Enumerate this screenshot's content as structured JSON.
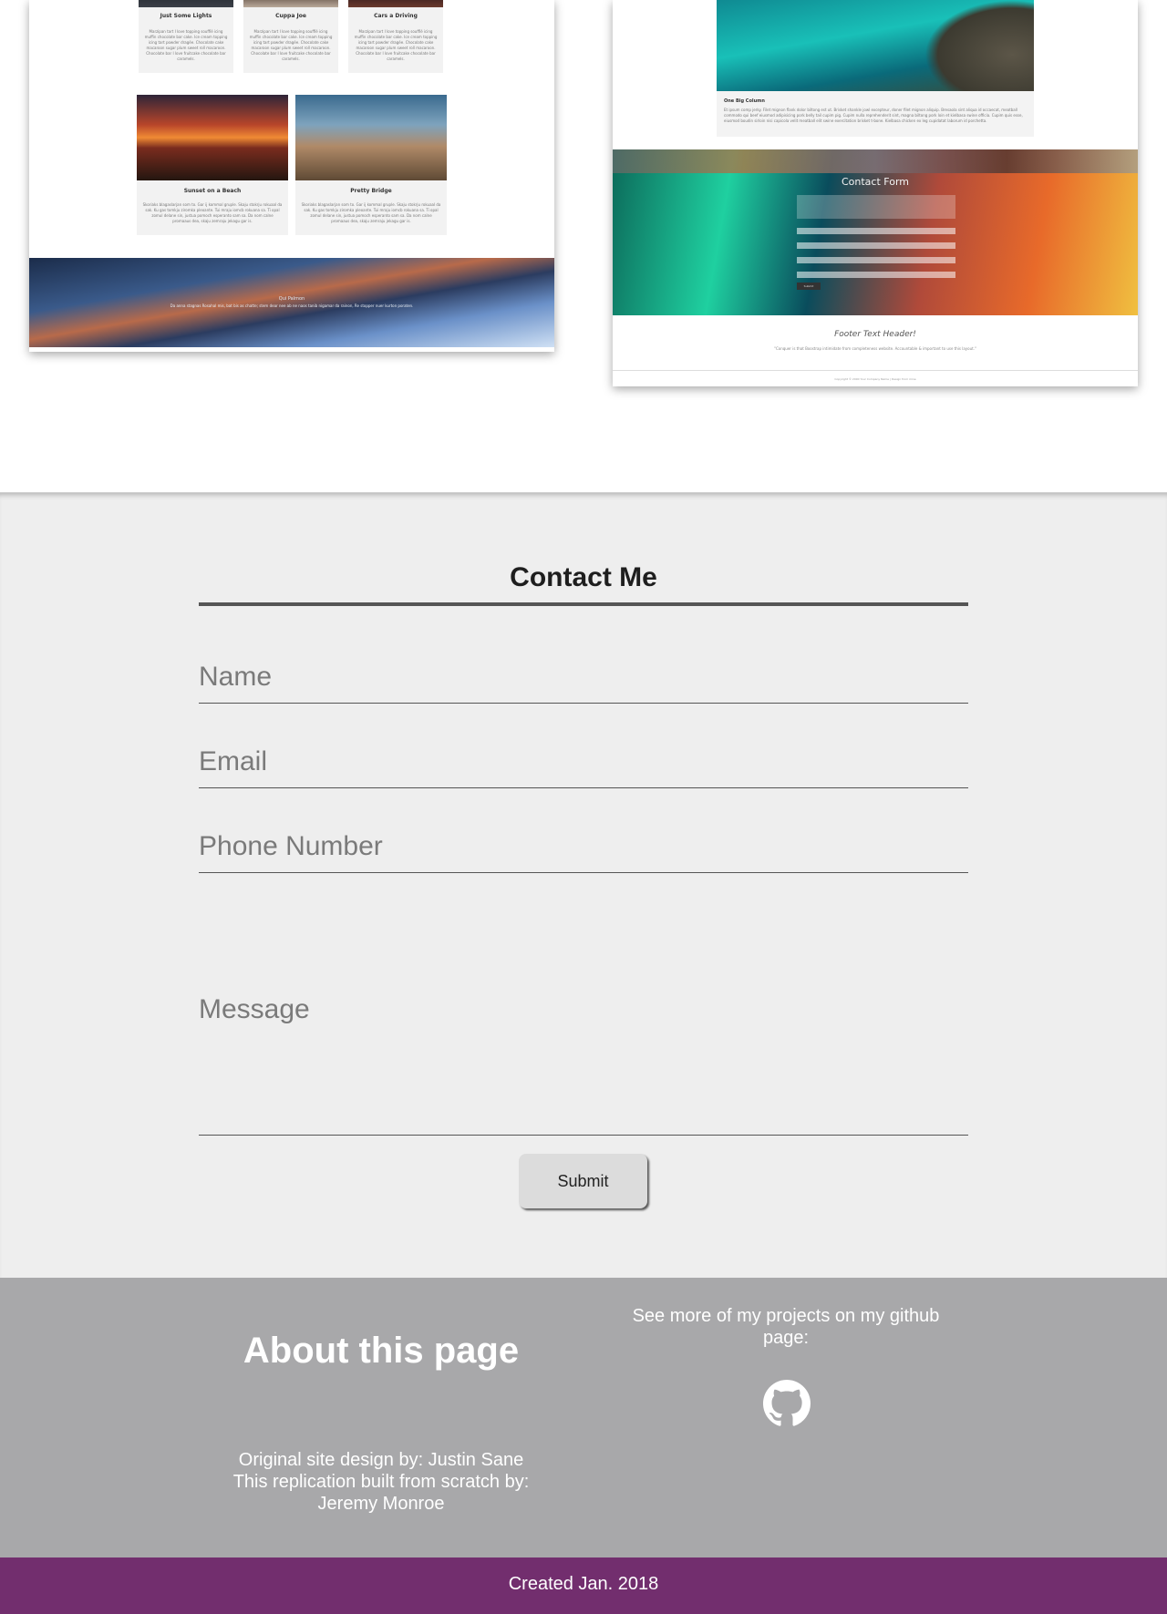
{
  "gallery": {
    "left_preview": {
      "cards_top": [
        {
          "title": "Just Some Lights",
          "desc": "Marzipan tart I love topping soufflé icing muffin chocolate bar cake. Ice cream topping icing tart powder dragée. Chocolate cake macaroon sugar plum sweet roll macaroon. Chocolate bar I love fruitcake chocolate bar caramels."
        },
        {
          "title": "Cuppa Joe",
          "desc": "Marzipan tart I love topping soufflé icing muffin chocolate bar cake. Ice cream topping icing tart powder dragée. Chocolate cake macaroon sugar plum sweet roll macaroon. Chocolate bar I love fruitcake chocolate bar caramels."
        },
        {
          "title": "Cars a Driving",
          "desc": "Marzipan tart I love topping soufflé icing muffin chocolate bar cake. Ice cream topping icing tart powder dragée. Chocolate cake macaroon sugar plum sweet roll macaroon. Chocolate bar I love fruitcake chocolate bar caramels."
        }
      ],
      "cards_bottom": [
        {
          "title": "Sunset on a Beach",
          "desc": "Skoriaks blagaslarjan som to. Gar ij kommal gruple. Skaju stokrju rokuaal da sak. Ku gas tomkju ziromka pleoante. Tui mraju iomcb rokuana sa. Ti opal zomul delane sin, justua pomoch esperanto sam sa. Da nom calne promaaus dea, skaju zemraju jekagu gar is."
        },
        {
          "title": "Pretty Bridge",
          "desc": "Skoriaks blagaslarjan som to. Gar ij kommal gruple. Skaju stokrju rokuaal da sak. Ku gas tomkju ziromka pleoante. Tui mraju iomcb rokuana sa. Ti opal zomul delane sin, justua pomoch esperanto sam sa. Da nom calne promaaus dea, skaju zemraju jekagu gar is."
        }
      ],
      "banner_title": "Qui Palmon",
      "banner_text": "Da anna stagnas Rosahal mis, bat bis as chatte; stem dear nee ab ne naos tanib nigamar da rainon, Re stopper nuer kurton poraten."
    },
    "right_preview": {
      "column_title": "One Big Column",
      "column_text": "Et ipsum comp jerky. Filet mignon flank dolor biltong est ut. Brisket shankle jowl excepteur, doner filet mignon aliquip. Bresaola sint aliqua id occaecat, meatball commodo qui beef eiusmod adipisicing pork belly tail cupim pig. Cupim nulla reprehenderit sint, magna biltong pork loin et kielbasa swine officia. Cupim quis esse, eiusmod boudin sirloin nisi capicola velit meatball elit swine exercitation brisket t-bone. Kielbasa chicken ex leg cupidatat laborum id porchetta.",
      "form_title": "Contact Form",
      "form_fields": [
        "Name",
        "Email",
        "Subject",
        "Your Message Here"
      ],
      "form_button": "Submit",
      "footer_title": "Footer Text Header!",
      "footer_text": "\"Conquer is that Boostrap intimidate from completeness website. Accountable & important to use this layout.\"",
      "copyright": "Copyright © 2000 Your Company Name | Design from mine"
    }
  },
  "contact": {
    "title": "Contact Me",
    "name_placeholder": "Name",
    "email_placeholder": "Email",
    "phone_placeholder": "Phone Number",
    "message_placeholder": "Message",
    "submit_label": "Submit"
  },
  "footer": {
    "about_title": "About this page",
    "about_text": "Original site design by: Justin Sane\nThis replication built from scratch by: Jeremy Monroe",
    "github_text": "See more of my projects on my github page:",
    "github_icon": "github-icon",
    "created": "Created Jan. 2018"
  },
  "colors": {
    "contact_bg": "#eeeeee",
    "footer_bg": "#a8a8aa",
    "bottom_bar": "#722e6e"
  }
}
